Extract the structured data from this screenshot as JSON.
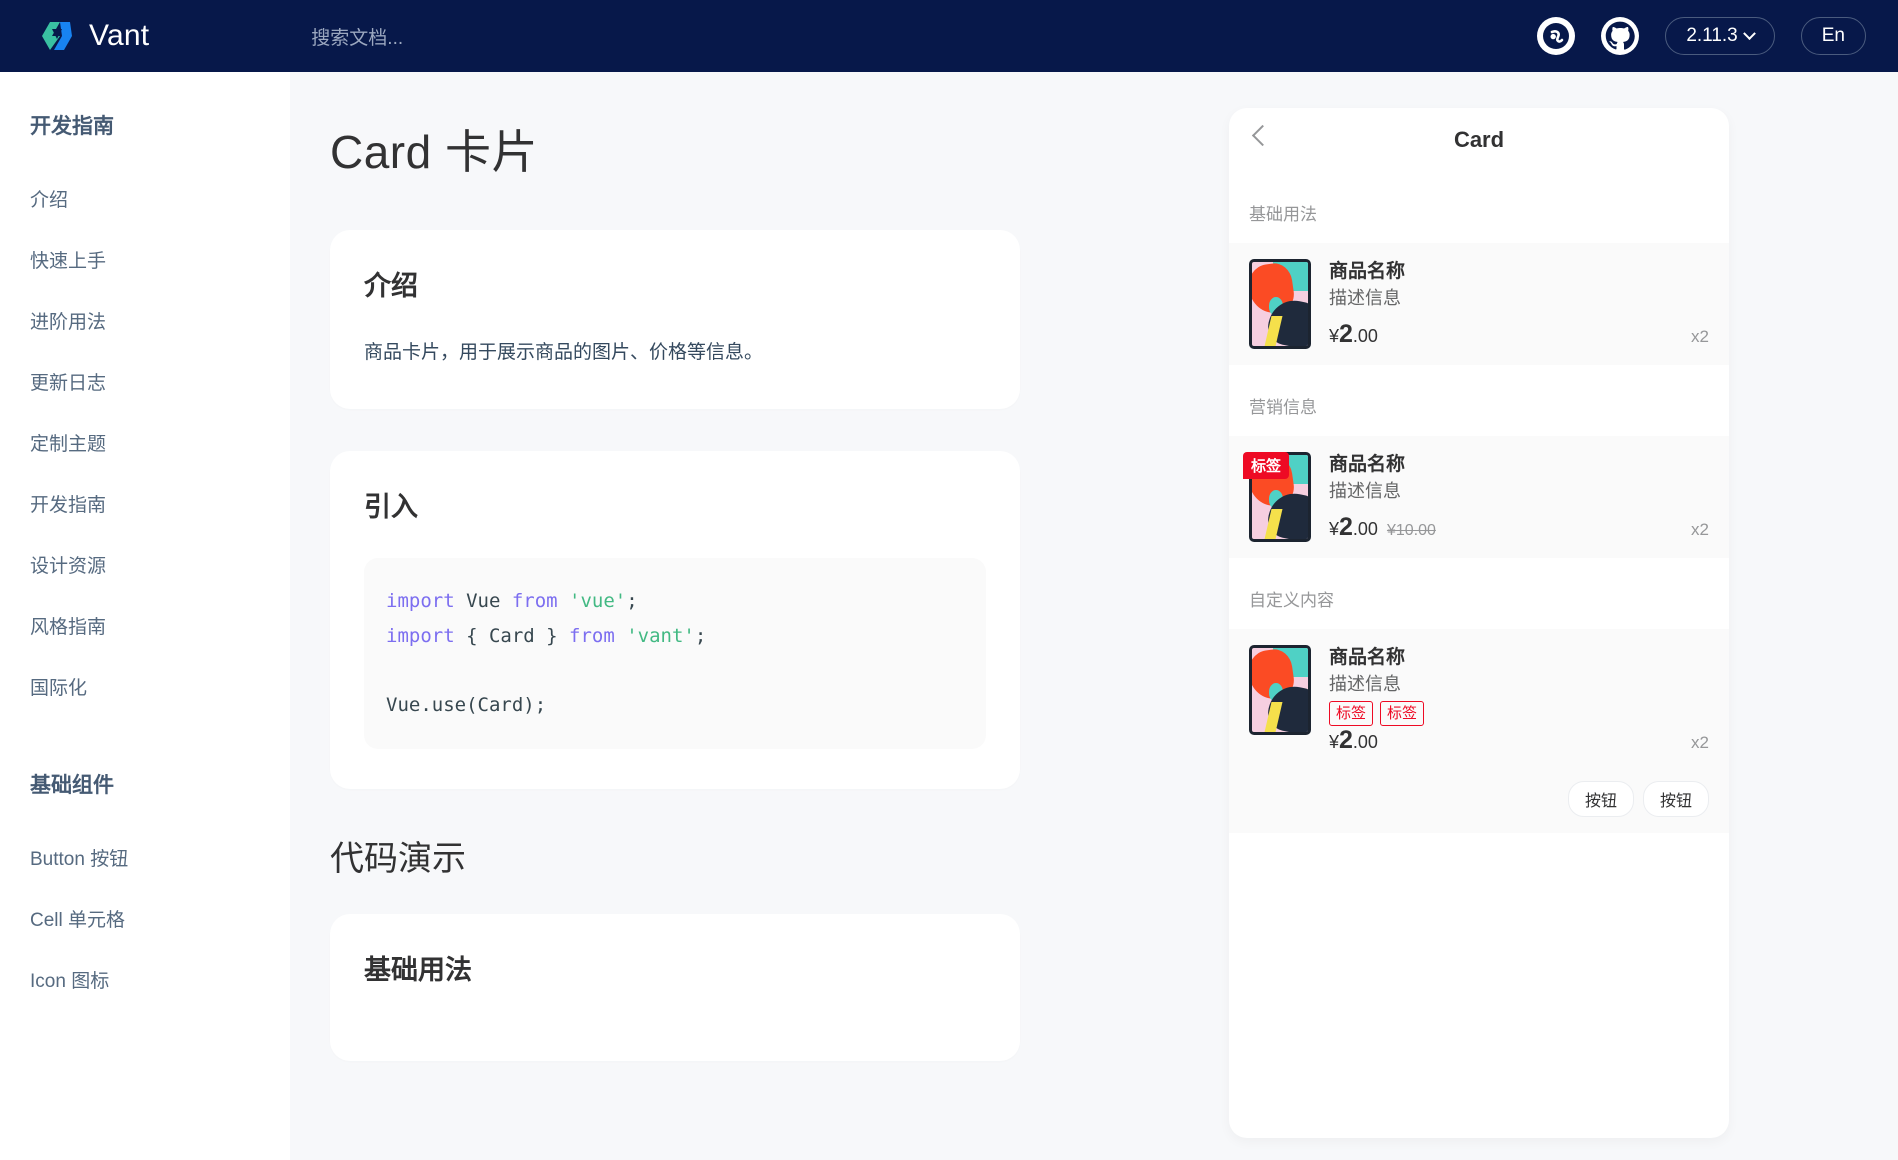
{
  "header": {
    "brand": "Vant",
    "search_placeholder": "搜索文档...",
    "wechat_icon": "wechat-miniprogram-icon",
    "github_icon": "github-icon",
    "version": "2.11.3",
    "language": "En"
  },
  "sidebar": {
    "groups": [
      {
        "title": "开发指南",
        "items": [
          {
            "label": "介绍"
          },
          {
            "label": "快速上手"
          },
          {
            "label": "进阶用法"
          },
          {
            "label": "更新日志"
          },
          {
            "label": "定制主题"
          },
          {
            "label": "开发指南"
          },
          {
            "label": "设计资源"
          },
          {
            "label": "风格指南"
          },
          {
            "label": "国际化"
          }
        ]
      },
      {
        "title": "基础组件",
        "items": [
          {
            "label": "Button 按钮"
          },
          {
            "label": "Cell 单元格"
          },
          {
            "label": "Icon 图标"
          }
        ]
      }
    ]
  },
  "main": {
    "page_title": "Card 卡片",
    "intro": {
      "heading": "介绍",
      "body": "商品卡片，用于展示商品的图片、价格等信息。"
    },
    "install": {
      "heading": "引入",
      "code": {
        "line1_kw1": "import",
        "line1_id": " Vue ",
        "line1_kw2": "from",
        "line1_str": " 'vue'",
        "line1_end": ";",
        "line2_kw1": "import",
        "line2_id": " { Card } ",
        "line2_kw2": "from",
        "line2_str": " 'vant'",
        "line2_end": ";",
        "line3": "Vue.use(Card);"
      }
    },
    "demo_section_title": "代码演示",
    "demo_card_heading": "基础用法"
  },
  "preview": {
    "nav_title": "Card",
    "back_icon": "chevron-left-icon",
    "sections": [
      {
        "title": "基础用法",
        "card": {
          "thumb_icon": "product-thumbnail",
          "title": "商品名称",
          "desc": "描述信息",
          "currency": "¥",
          "price_int": "2",
          "price_dec": ".00",
          "origin_price": "",
          "num": "x2",
          "tag": "",
          "tags": [],
          "buttons": []
        }
      },
      {
        "title": "营销信息",
        "card": {
          "thumb_icon": "product-thumbnail",
          "title": "商品名称",
          "desc": "描述信息",
          "currency": "¥",
          "price_int": "2",
          "price_dec": ".00",
          "origin_price": "¥10.00",
          "num": "x2",
          "tag": "标签",
          "tags": [],
          "buttons": []
        }
      },
      {
        "title": "自定义内容",
        "card": {
          "thumb_icon": "product-thumbnail",
          "title": "商品名称",
          "desc": "描述信息",
          "currency": "¥",
          "price_int": "2",
          "price_dec": ".00",
          "origin_price": "",
          "num": "x2",
          "tag": "",
          "tags": [
            "标签",
            "标签"
          ],
          "buttons": [
            "按钮",
            "按钮"
          ]
        }
      }
    ]
  },
  "colors": {
    "header_bg": "#07184a",
    "accent_red": "#ee0a24",
    "brand_green": "#42b983",
    "keyword_purple": "#7c6ef0"
  }
}
